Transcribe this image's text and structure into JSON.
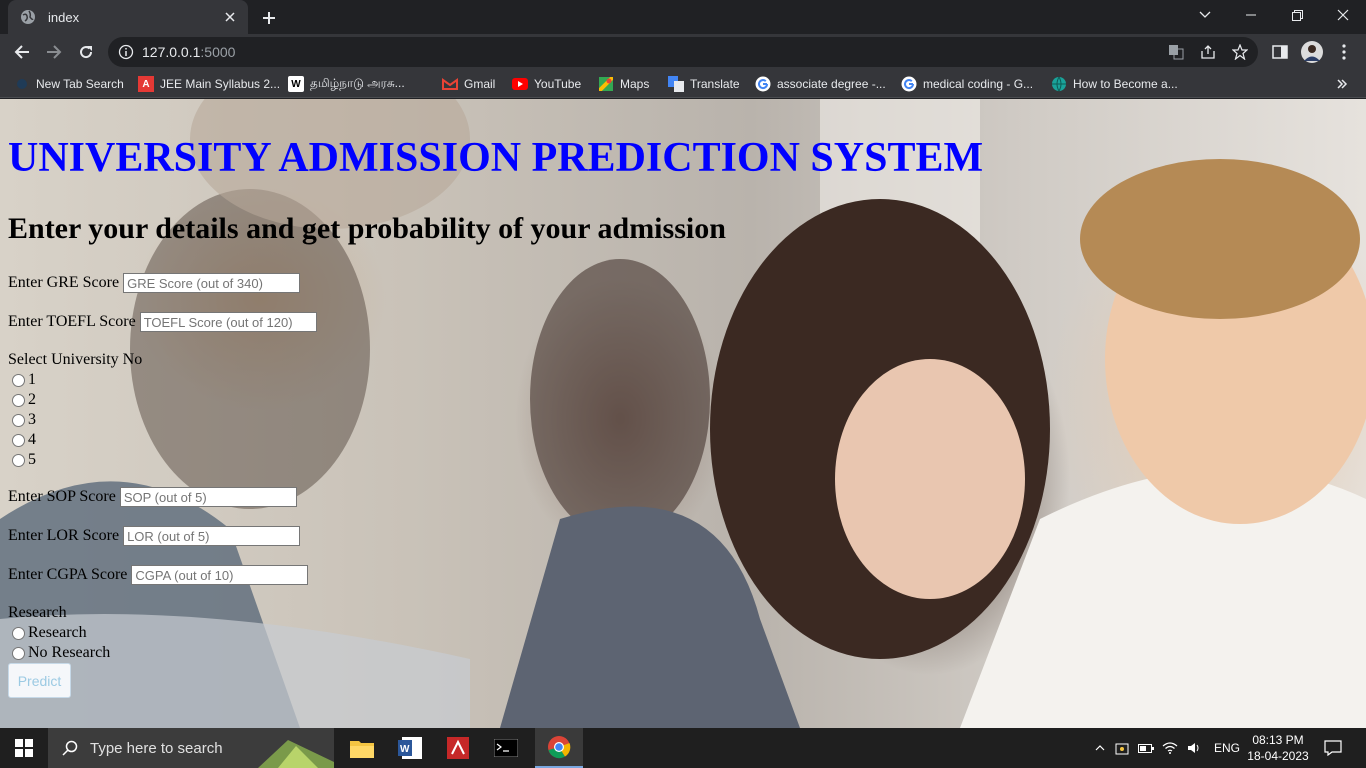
{
  "browser": {
    "tab_title": "index",
    "url_host": "127.0.0.1",
    "url_port": ":5000",
    "bookmarks": [
      {
        "label": "New Tab Search",
        "icon": "search-icon"
      },
      {
        "label": "JEE Main Syllabus 2...",
        "icon": "a-logo-icon"
      },
      {
        "label": "தமிழ்நாடு அரசு...",
        "icon": "w-logo-icon"
      },
      {
        "label": "Gmail",
        "icon": "gmail-icon"
      },
      {
        "label": "YouTube",
        "icon": "youtube-icon"
      },
      {
        "label": "Maps",
        "icon": "maps-icon"
      },
      {
        "label": "Translate",
        "icon": "translate-icon"
      },
      {
        "label": "associate degree -...",
        "icon": "google-icon"
      },
      {
        "label": "medical coding - G...",
        "icon": "google-icon"
      },
      {
        "label": "How to Become a...",
        "icon": "globe-icon"
      }
    ]
  },
  "page": {
    "heading": "UNIVERSITY ADMISSION PREDICTION SYSTEM",
    "subheading": "Enter your details and get probability of your admission",
    "gre": {
      "label": "Enter GRE Score",
      "placeholder": "GRE Score (out of 340)"
    },
    "toefl": {
      "label": "Enter TOEFL Score",
      "placeholder": "TOEFL Score (out of 120)"
    },
    "university": {
      "label": "Select University No",
      "options": [
        "1",
        "2",
        "3",
        "4",
        "5"
      ]
    },
    "sop": {
      "label": "Enter SOP Score",
      "placeholder": "SOP (out of 5)"
    },
    "lor": {
      "label": "Enter LOR Score",
      "placeholder": "LOR (out of 5)"
    },
    "cgpa": {
      "label": "Enter CGPA Score",
      "placeholder": "CGPA (out of 10)"
    },
    "research": {
      "label": "Research",
      "options": [
        "Research",
        "No Research"
      ]
    },
    "predict_label": "Predict"
  },
  "taskbar": {
    "search_placeholder": "Type here to search",
    "language": "ENG",
    "time": "08:13 PM",
    "date": "18-04-2023"
  },
  "colors": {
    "heading": "#0000ff",
    "chrome_dark": "#202124",
    "chrome_mid": "#35363a"
  }
}
